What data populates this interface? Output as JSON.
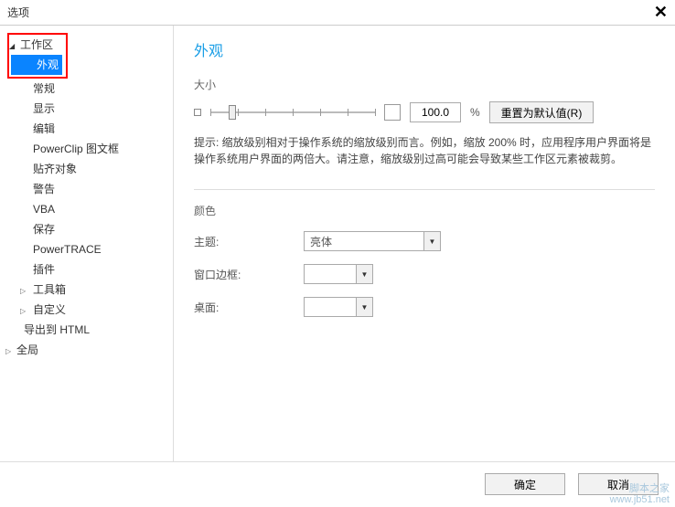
{
  "window": {
    "title": "选项"
  },
  "sidebar": {
    "root": "工作区",
    "items": [
      "外观",
      "常规",
      "显示",
      "编辑",
      "PowerClip 图文框",
      "贴齐对象",
      "警告",
      "VBA",
      "保存",
      "PowerTRACE",
      "插件"
    ],
    "more": [
      "工具箱",
      "自定义"
    ],
    "export": "导出到 HTML",
    "global": "全局"
  },
  "content": {
    "title": "外观",
    "size_label": "大小",
    "scale_value": "100.0",
    "percent": "%",
    "reset_btn": "重置为默认值(R)",
    "hint": "提示: 缩放级别相对于操作系统的缩放级别而言。例如，缩放 200% 时，应用程序用户界面将是操作系统用户界面的两倍大。请注意，缩放级别过高可能会导致某些工作区元素被裁剪。",
    "color_label": "颜色",
    "theme_label": "主题:",
    "theme_value": "亮体",
    "border_label": "窗口边框:",
    "desktop_label": "桌面:"
  },
  "footer": {
    "ok": "确定",
    "cancel": "取消"
  },
  "watermark": {
    "line1": "脚本之家",
    "line2": "www.jb51.net"
  }
}
